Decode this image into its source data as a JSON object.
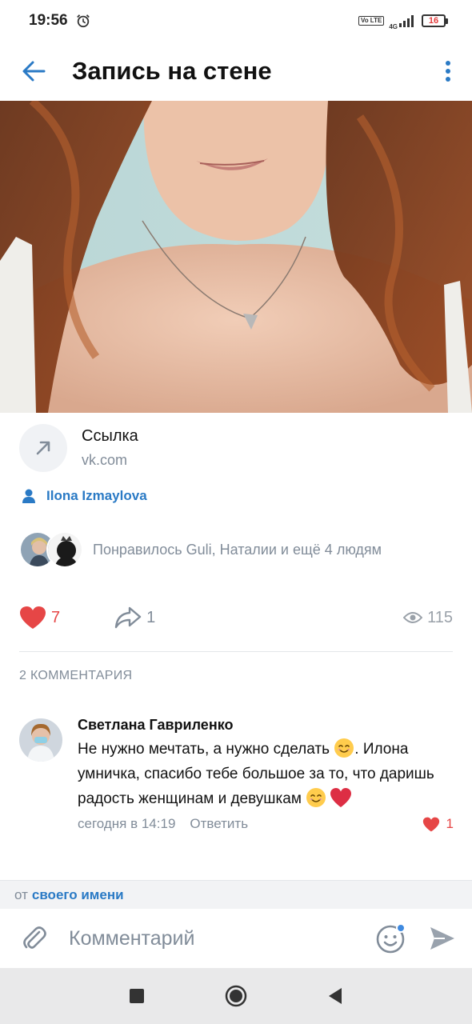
{
  "status_bar": {
    "time": "19:56",
    "volte": "Vo LTE",
    "network": "4G",
    "battery": "16",
    "icons": [
      "alarm-icon",
      "volte-icon",
      "signal-icon",
      "battery-icon"
    ]
  },
  "header": {
    "title": "Запись на стене",
    "back_icon": "arrow-left-icon",
    "menu_icon": "more-vertical-icon",
    "accent": "#2a7ac5"
  },
  "post": {
    "link": {
      "title": "Ссылка",
      "domain": "vk.com",
      "icon": "arrow-up-right-icon"
    },
    "author": "Ilona Izmaylova",
    "likers_text": "Понравилось Guli, Наталии и ещё 4 людям",
    "likes": "7",
    "shares": "1",
    "views": "115",
    "like_color": "#e64646"
  },
  "comments": {
    "header": "2 КОММЕНТАРИЯ",
    "items": [
      {
        "author": "Светлана Гавриленко",
        "text_1": "Не нужно мечтать, а нужно сделать ",
        "text_2": ". Илона умничка, спасибо тебе большое за то, что даришь радость женщинам и девушкам ",
        "time": "сегодня в 14:19",
        "reply_label": "Ответить",
        "likes": "1"
      }
    ]
  },
  "composer": {
    "from_prefix": "от",
    "from_link": "своего имени",
    "placeholder": "Комментарий"
  },
  "navbar": {
    "icons": [
      "recents-square-icon",
      "home-circle-icon",
      "back-triangle-icon"
    ]
  }
}
